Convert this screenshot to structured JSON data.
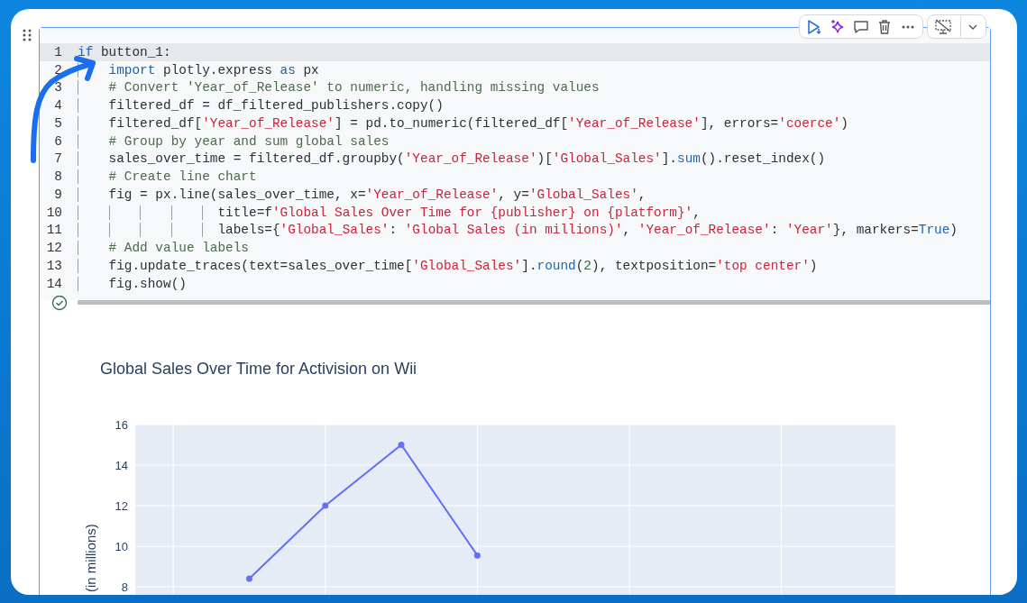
{
  "code_cell": {
    "lines": [
      {
        "number": "1",
        "current": true,
        "kind": "top",
        "tokens": [
          {
            "kind": "keyword",
            "text": "if"
          },
          {
            "kind": "plain",
            "text": " button_1:"
          }
        ]
      },
      {
        "number": "2",
        "current": false,
        "kind": "block",
        "tokens": [
          {
            "kind": "keyword",
            "text": "import"
          },
          {
            "kind": "plain",
            "text": " plotly.express "
          },
          {
            "kind": "keyword",
            "text": "as"
          },
          {
            "kind": "plain",
            "text": " px"
          }
        ]
      },
      {
        "number": "3",
        "current": false,
        "kind": "block",
        "tokens": [
          {
            "kind": "comment",
            "text": "# Convert 'Year_of_Release' to numeric, handling missing values"
          }
        ]
      },
      {
        "number": "4",
        "current": false,
        "kind": "block",
        "tokens": [
          {
            "kind": "plain",
            "text": "filtered_df = df_filtered_publishers.copy()"
          }
        ]
      },
      {
        "number": "5",
        "current": false,
        "kind": "block",
        "tokens": [
          {
            "kind": "plain",
            "text": "filtered_df["
          },
          {
            "kind": "string",
            "text": "'Year_of_Release'"
          },
          {
            "kind": "plain",
            "text": "] = pd.to_numeric(filtered_df["
          },
          {
            "kind": "string",
            "text": "'Year_of_Release'"
          },
          {
            "kind": "plain",
            "text": "], errors="
          },
          {
            "kind": "string",
            "text": "'coerce'"
          },
          {
            "kind": "plain",
            "text": ")"
          }
        ]
      },
      {
        "number": "6",
        "current": false,
        "kind": "block",
        "tokens": [
          {
            "kind": "comment",
            "text": "# Group by year and sum global sales"
          }
        ]
      },
      {
        "number": "7",
        "current": false,
        "kind": "block",
        "tokens": [
          {
            "kind": "plain",
            "text": "sales_over_time = filtered_df.groupby("
          },
          {
            "kind": "string",
            "text": "'Year_of_Release'"
          },
          {
            "kind": "plain",
            "text": ")["
          },
          {
            "kind": "string",
            "text": "'Global_Sales'"
          },
          {
            "kind": "plain",
            "text": "]."
          },
          {
            "kind": "builtin",
            "text": "sum"
          },
          {
            "kind": "plain",
            "text": "().reset_index()"
          }
        ]
      },
      {
        "number": "8",
        "current": false,
        "kind": "block",
        "tokens": [
          {
            "kind": "comment",
            "text": "# Create line chart"
          }
        ]
      },
      {
        "number": "9",
        "current": false,
        "kind": "block",
        "tokens": [
          {
            "kind": "plain",
            "text": "fig = px.line(sales_over_time, x="
          },
          {
            "kind": "string",
            "text": "'Year_of_Release'"
          },
          {
            "kind": "plain",
            "text": ", y="
          },
          {
            "kind": "string",
            "text": "'Global_Sales'"
          },
          {
            "kind": "plain",
            "text": ","
          }
        ]
      },
      {
        "number": "10",
        "current": false,
        "kind": "continuation",
        "tokens": [
          {
            "kind": "plain",
            "text": "title=f"
          },
          {
            "kind": "string",
            "text": "'Global Sales Over Time for {publisher} on {platform}'"
          },
          {
            "kind": "plain",
            "text": ","
          }
        ]
      },
      {
        "number": "11",
        "current": false,
        "kind": "continuation",
        "tokens": [
          {
            "kind": "plain",
            "text": "labels={"
          },
          {
            "kind": "string",
            "text": "'Global_Sales'"
          },
          {
            "kind": "plain",
            "text": ": "
          },
          {
            "kind": "string",
            "text": "'Global Sales (in millions)'"
          },
          {
            "kind": "plain",
            "text": ", "
          },
          {
            "kind": "string",
            "text": "'Year_of_Release'"
          },
          {
            "kind": "plain",
            "text": ": "
          },
          {
            "kind": "string",
            "text": "'Year'"
          },
          {
            "kind": "plain",
            "text": "}, markers="
          },
          {
            "kind": "builtin",
            "text": "True"
          },
          {
            "kind": "plain",
            "text": ")"
          }
        ]
      },
      {
        "number": "12",
        "current": false,
        "kind": "block",
        "tokens": [
          {
            "kind": "comment",
            "text": "# Add value labels"
          }
        ]
      },
      {
        "number": "13",
        "current": false,
        "kind": "block",
        "tokens": [
          {
            "kind": "plain",
            "text": "fig.update_traces(text=sales_over_time["
          },
          {
            "kind": "string",
            "text": "'Global_Sales'"
          },
          {
            "kind": "plain",
            "text": "]."
          },
          {
            "kind": "builtin",
            "text": "round"
          },
          {
            "kind": "plain",
            "text": "("
          },
          {
            "kind": "number",
            "text": "2"
          },
          {
            "kind": "plain",
            "text": "), textposition="
          },
          {
            "kind": "string",
            "text": "'top center'"
          },
          {
            "kind": "plain",
            "text": ")"
          }
        ]
      },
      {
        "number": "14",
        "current": false,
        "kind": "block",
        "tokens": [
          {
            "kind": "plain",
            "text": "fig.show()"
          }
        ]
      }
    ]
  },
  "output": {
    "chart_data": {
      "type": "line",
      "title": "Global Sales Over Time for Activision on Wii",
      "ylabel": "(in millions)",
      "categories": [
        null,
        null,
        null,
        null,
        null,
        null,
        null,
        null,
        null,
        null
      ],
      "ylim": [
        7.6,
        16
      ],
      "yticks": [
        8,
        10,
        12,
        14,
        16
      ],
      "grid": true,
      "series": [
        {
          "color": "#636efa",
          "marker": "circle",
          "values": [
            null,
            8.4,
            12,
            15,
            9.55,
            null,
            null,
            null,
            null,
            null
          ]
        }
      ]
    }
  }
}
